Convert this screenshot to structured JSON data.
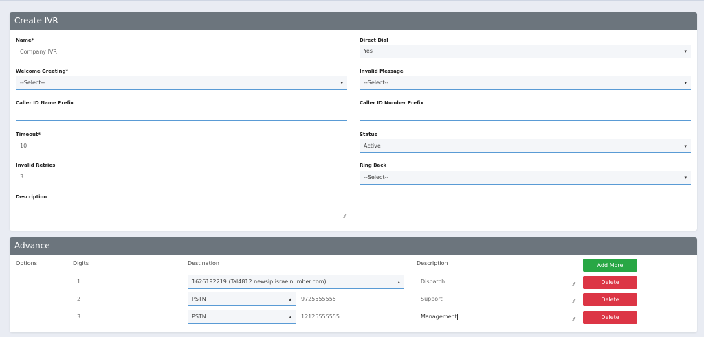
{
  "create": {
    "title": "Create IVR",
    "fields": {
      "name": {
        "label": "Name*",
        "value": "Company IVR"
      },
      "direct_dial": {
        "label": "Direct Dial",
        "value": "Yes"
      },
      "welcome_greeting": {
        "label": "Welcome Greeting*",
        "value": "--Select--"
      },
      "invalid_message": {
        "label": "Invalid Message",
        "value": "--Select--"
      },
      "caller_id_name_prefix": {
        "label": "Caller ID Name Prefix",
        "value": ""
      },
      "caller_id_number_prefix": {
        "label": "Caller ID Number Prefix",
        "value": ""
      },
      "timeout": {
        "label": "Timeout*",
        "value": "10"
      },
      "status": {
        "label": "Status",
        "value": "Active"
      },
      "invalid_retries": {
        "label": "Invalid Retries",
        "value": "3"
      },
      "ring_back": {
        "label": "Ring Back",
        "value": "--Select--"
      },
      "description": {
        "label": "Description",
        "value": ""
      }
    }
  },
  "advance": {
    "title": "Advance",
    "headers": {
      "options": "Options",
      "digits": "Digits",
      "destination": "Destination",
      "description": "Description"
    },
    "add_more_label": "Add More",
    "delete_label": "Delete",
    "rows": [
      {
        "digit": "1",
        "destination": "1626192219 (Tal4812.newsip.israelnumber.com)",
        "number": "",
        "description": "Dispatch"
      },
      {
        "digit": "2",
        "destination": "PSTN",
        "number": "9725555555",
        "description": "Support"
      },
      {
        "digit": "3",
        "destination": "PSTN",
        "number": "12125555555",
        "description": "Management"
      }
    ]
  },
  "icons": {
    "caret_down": "▾",
    "caret_up": "▴",
    "resize": "⁄⁄"
  }
}
